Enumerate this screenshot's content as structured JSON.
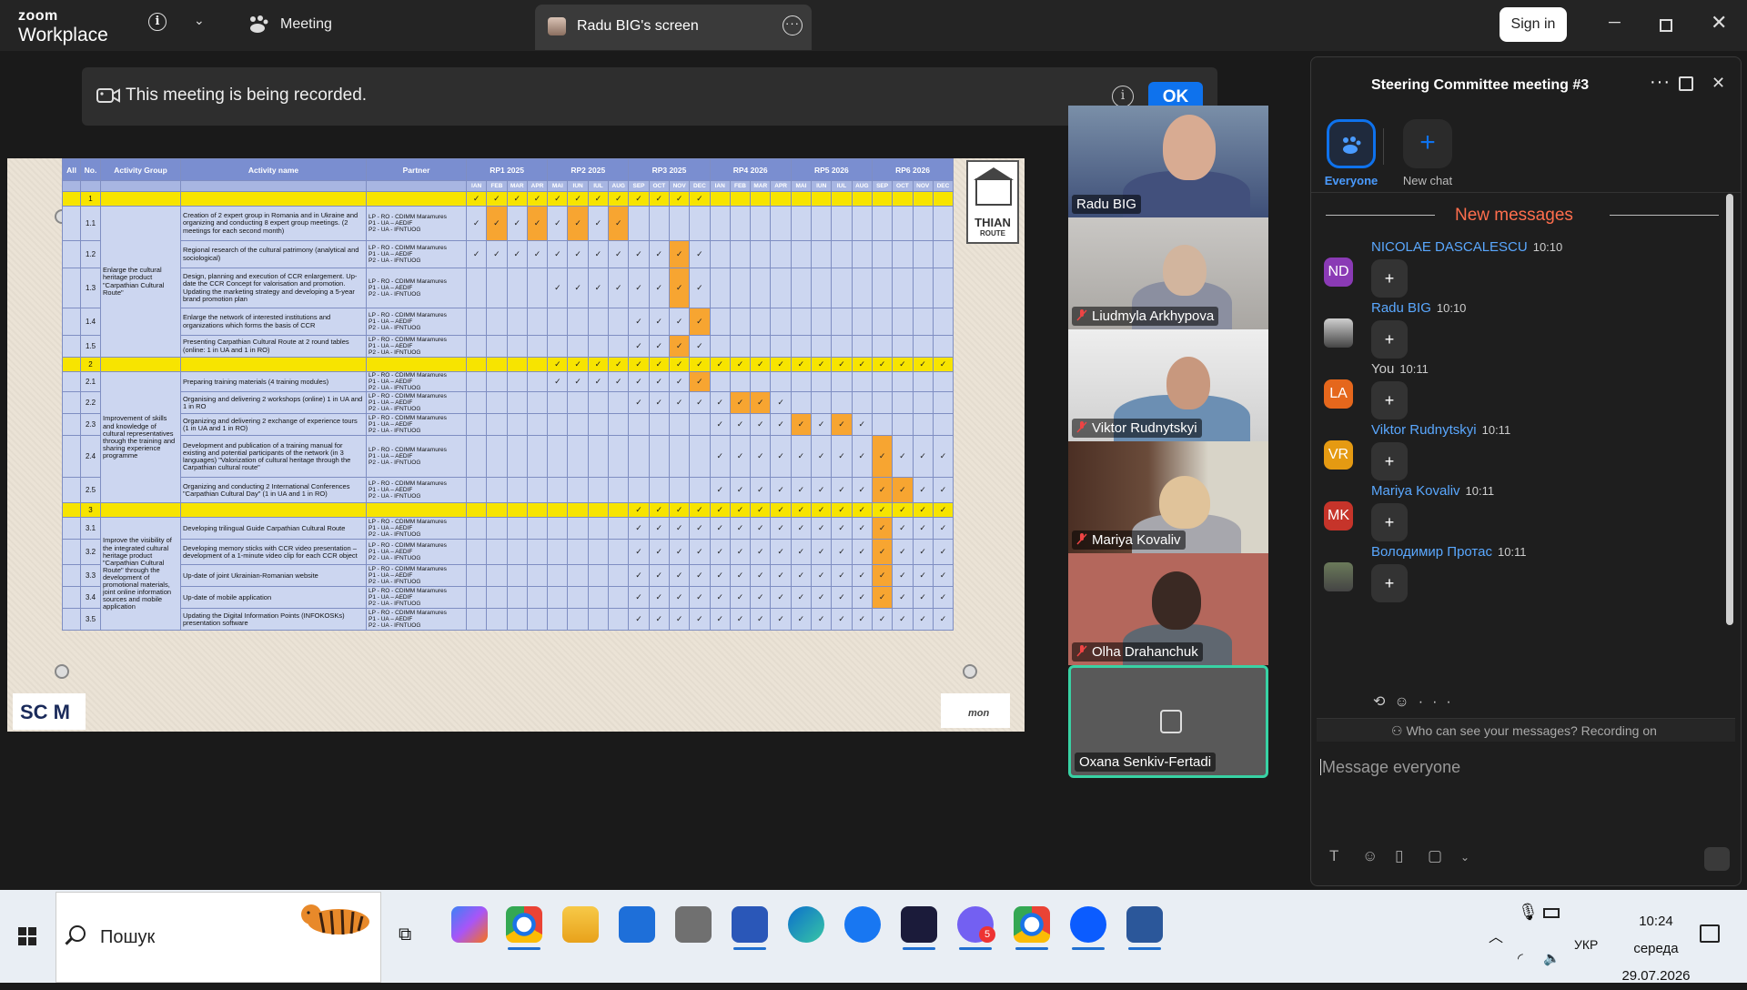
{
  "app": {
    "logo_line1": "zoom",
    "logo_line2": "Workplace",
    "meeting_tab": "Meeting",
    "screen_tab": "Radu BIG's screen",
    "sign_in": "Sign in"
  },
  "banner": {
    "text": "This meeting is being recorded.",
    "ok": "OK"
  },
  "slide": {
    "headers": [
      "All",
      "No.",
      "Activity Group",
      "Activity name",
      "Partner",
      "RP1 2025",
      "RP2 2025",
      "RP3 2025",
      "RP4 2026",
      "RP5 2026",
      "RP6 2026"
    ],
    "months": [
      "IAN",
      "FEB",
      "MAR",
      "APR",
      "MAI",
      "IUN",
      "IUL",
      "AUG",
      "SEP",
      "OCT",
      "NOV",
      "DEC",
      "IAN",
      "FEB",
      "MAR",
      "APR",
      "MAI",
      "IUN",
      "IUL",
      "AUG",
      "SEP",
      "OCT",
      "NOV",
      "DEC"
    ],
    "partner": "LP - RO - CDIMM Maramures\nP1 - UA – AEDIF\nP2 - UA - IFNTUOG",
    "groups": [
      "Enlarge the cultural heritage product \"Carpathian Cultural Route\"",
      "Improvement of skills and knowledge of cultural representatives through the training and sharing experience programme",
      "Improve the visibility of the integrated cultural heritage product \"Carpathian Cultural Route\" through the development of promotional materials, joint online information sources and mobile application"
    ],
    "rows": [
      {
        "no": "1",
        "group": true
      },
      {
        "no": "1.1",
        "name": "Creation of 2 expert group in Romania and in Ukraine and organizing and conducting 8 expert group meetings. (2 meetings for each second month)"
      },
      {
        "no": "1.2",
        "name": "Regional research of the cultural patrimony (analytical and sociological)"
      },
      {
        "no": "1.3",
        "name": "Design, planning and execution of CCR enlargement. Up-date the CCR Concept for valorisation and promotion. Updating the marketing strategy and developing a 5-year brand promotion plan"
      },
      {
        "no": "1.4",
        "name": "Enlarge the network of interested institutions and organizations which forms the basis of CCR"
      },
      {
        "no": "1.5",
        "name": "Presenting Carpathian Cultural Route at 2 round tables (online: 1 in UA and 1 in RO)"
      },
      {
        "no": "2",
        "group": true
      },
      {
        "no": "2.1",
        "name": "Preparing training materials (4 training modules)"
      },
      {
        "no": "2.2",
        "name": "Organising and delivering 2 workshops (online) 1 in UA and 1 in RO"
      },
      {
        "no": "2.3",
        "name": "Organizing and delivering 2 exchange of experience tours (1 in UA and 1 in RO)"
      },
      {
        "no": "2.4",
        "name": "Development and publication of a training manual for existing and potential participants of the network (in 3 languages) \"Valorization of cultural heritage through the Carpathian cultural route\""
      },
      {
        "no": "2.5",
        "name": "Organizing and conducting 2 International Conferences \"Carpathian Cultural Day\" (1 in UA and 1 in RO)"
      },
      {
        "no": "3",
        "group": true
      },
      {
        "no": "3.1",
        "name": "Developing trilingual Guide Carpathian Cultural Route"
      },
      {
        "no": "3.2",
        "name": "Developing memory sticks with CCR video presentation – development of a 1-minute video clip for each CCR object"
      },
      {
        "no": "3.3",
        "name": "Up-date of joint Ukrainian-Romanian website"
      },
      {
        "no": "3.4",
        "name": "Up-date of mobile application"
      },
      {
        "no": "3.5",
        "name": "Updating the Digital Information Points (INFOKOSKs) presentation software"
      }
    ],
    "logo_text": "THIAN",
    "logo_sub": "ROUTE",
    "sc_text": "SC M",
    "foot_text": "mon"
  },
  "participants": [
    {
      "name": "Radu BIG",
      "muted": false
    },
    {
      "name": "Liudmyla Arkhypova",
      "muted": true
    },
    {
      "name": "Viktor Rudnytskyi",
      "muted": true
    },
    {
      "name": "Mariya Kovaliv",
      "muted": true
    },
    {
      "name": "Olha Drahanchuk",
      "muted": true
    },
    {
      "name": "Oxana Senkiv-Fertadi",
      "muted": false
    }
  ],
  "chat": {
    "title": "Steering Committee meeting #3",
    "channels": [
      {
        "label": "Everyone",
        "selected": true
      },
      {
        "label": "New chat",
        "selected": false
      }
    ],
    "new_messages": "New messages",
    "messages": [
      {
        "initials": "ND",
        "name": "NICOLAE DASCALESCU",
        "time": "10:10",
        "color": "#8a3ab5",
        "reaction": "+"
      },
      {
        "initials": "",
        "name": "Radu BIG",
        "time": "10:10",
        "color": "#cfcfcf",
        "reaction": "+"
      },
      {
        "initials": "LA",
        "name": "You",
        "time": "10:11",
        "color": "#e5671c",
        "reaction": "+"
      },
      {
        "initials": "VR",
        "name": "Viktor Rudnytskyi",
        "time": "10:11",
        "color": "#e59a12",
        "reaction": "+"
      },
      {
        "initials": "MK",
        "name": "Mariya Kovaliv",
        "time": "10:11",
        "color": "#c6342a",
        "reaction": "+"
      },
      {
        "initials": "",
        "name": "Володимир Протас",
        "time": "10:11",
        "color": "#6b7a5a",
        "reaction": "+"
      }
    ],
    "who_can_see": "Who can see your messages? Recording on",
    "compose_placeholder": "Message everyone"
  },
  "taskbar": {
    "search_placeholder": "Пошук",
    "time": "10:24",
    "day": "середа",
    "date": "29.07.2026",
    "lang": "УКР",
    "viber_badge": "5"
  },
  "colors": {
    "zoom_blue": "#0e72ed",
    "active_tile": "#38d2a4",
    "new_messages": "#ff6e4d"
  }
}
